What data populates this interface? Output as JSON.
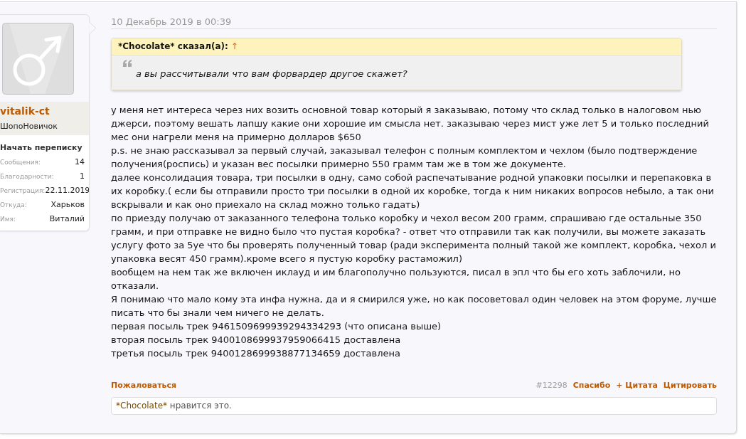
{
  "author": {
    "name": "vitalik-ct",
    "title": "ШопоНовичок",
    "action": "Начать переписку",
    "stats": [
      {
        "label": "Сообщения:",
        "value": "14"
      },
      {
        "label": "Благодарности:",
        "value": "1"
      },
      {
        "label": "Регистрация:",
        "value": "22.11.2019"
      },
      {
        "label": "Откуда:",
        "value": "Харьков"
      },
      {
        "label": "Имя:",
        "value": "Виталий"
      }
    ]
  },
  "post": {
    "date": "10 Декабрь 2019 в 00:39",
    "quote": {
      "attribution": "*Chocolate* сказал(а):",
      "jump": "↑",
      "text": "а вы рассчитывали что вам форвардер другое скажет?"
    },
    "paragraphs": [
      "у меня нет интереса через них возить основной товар который я заказываю, потому что склад только в налоговом нью джерси, поэтому вешать лапшу какие они хорошие им смысла нет. заказываю через мист уже лет 5 и только последний мес они нагрели меня на примерно долларов $650",
      "p.s. не знаю рассказывал за первый случай, заказывал телефон с полным комплектом и чехлом (было подтверждение получения(роспись) и указан вес посылки примерно 550 грамм там же в том же документе.",
      "далее консолидация товара, три посылки в одну, само собой распечатывание родной упаковки посылки и перепаковка в их коробку.( если бы отправили просто три посылки в одной их коробке, тогда к ним никаких вопросов небыло, а так они вскрывали и как оно приехало на склад можно только гадать)",
      "по приезду получаю от заказанного телефона только коробку и чехол весом 200 грамм, спрашиваю где остальные 350 грамм, и при отправке не видно было что пустая коробка? - ответ что отправили так как получили, вы можете заказать услугу фото за 5уе что бы проверять полученный товар (ради эксперимента полный такой же комплект, коробка, чехол и упаковка весят 450 грамм).кроме всего я пустую коробку растаможил)",
      "вообщем на нем так же включен иклауд и им благополучно пользуются, писал в эпл что бы его хоть заблочили, но отказали.",
      "Я понимаю что мало кому эта инфа нужна, да и я смирился уже, но как посоветовал один человек на этом форуме, лучше писать что бы знали чем ничего не делать.",
      "первая посыль трек 9461509699939294334293 (что описана выше)",
      "вторая посыль трек 9400108699937959066415 доставлена",
      "третья посыль трек 9400128699938877134659 доставлена"
    ],
    "footer": {
      "report": "Пожаловаться",
      "number": "#12298",
      "actions": [
        "Спасибо",
        "+ Цитата",
        "Цитировать"
      ]
    },
    "likes": {
      "user": "*Chocolate*",
      "text": "нравится это."
    }
  }
}
